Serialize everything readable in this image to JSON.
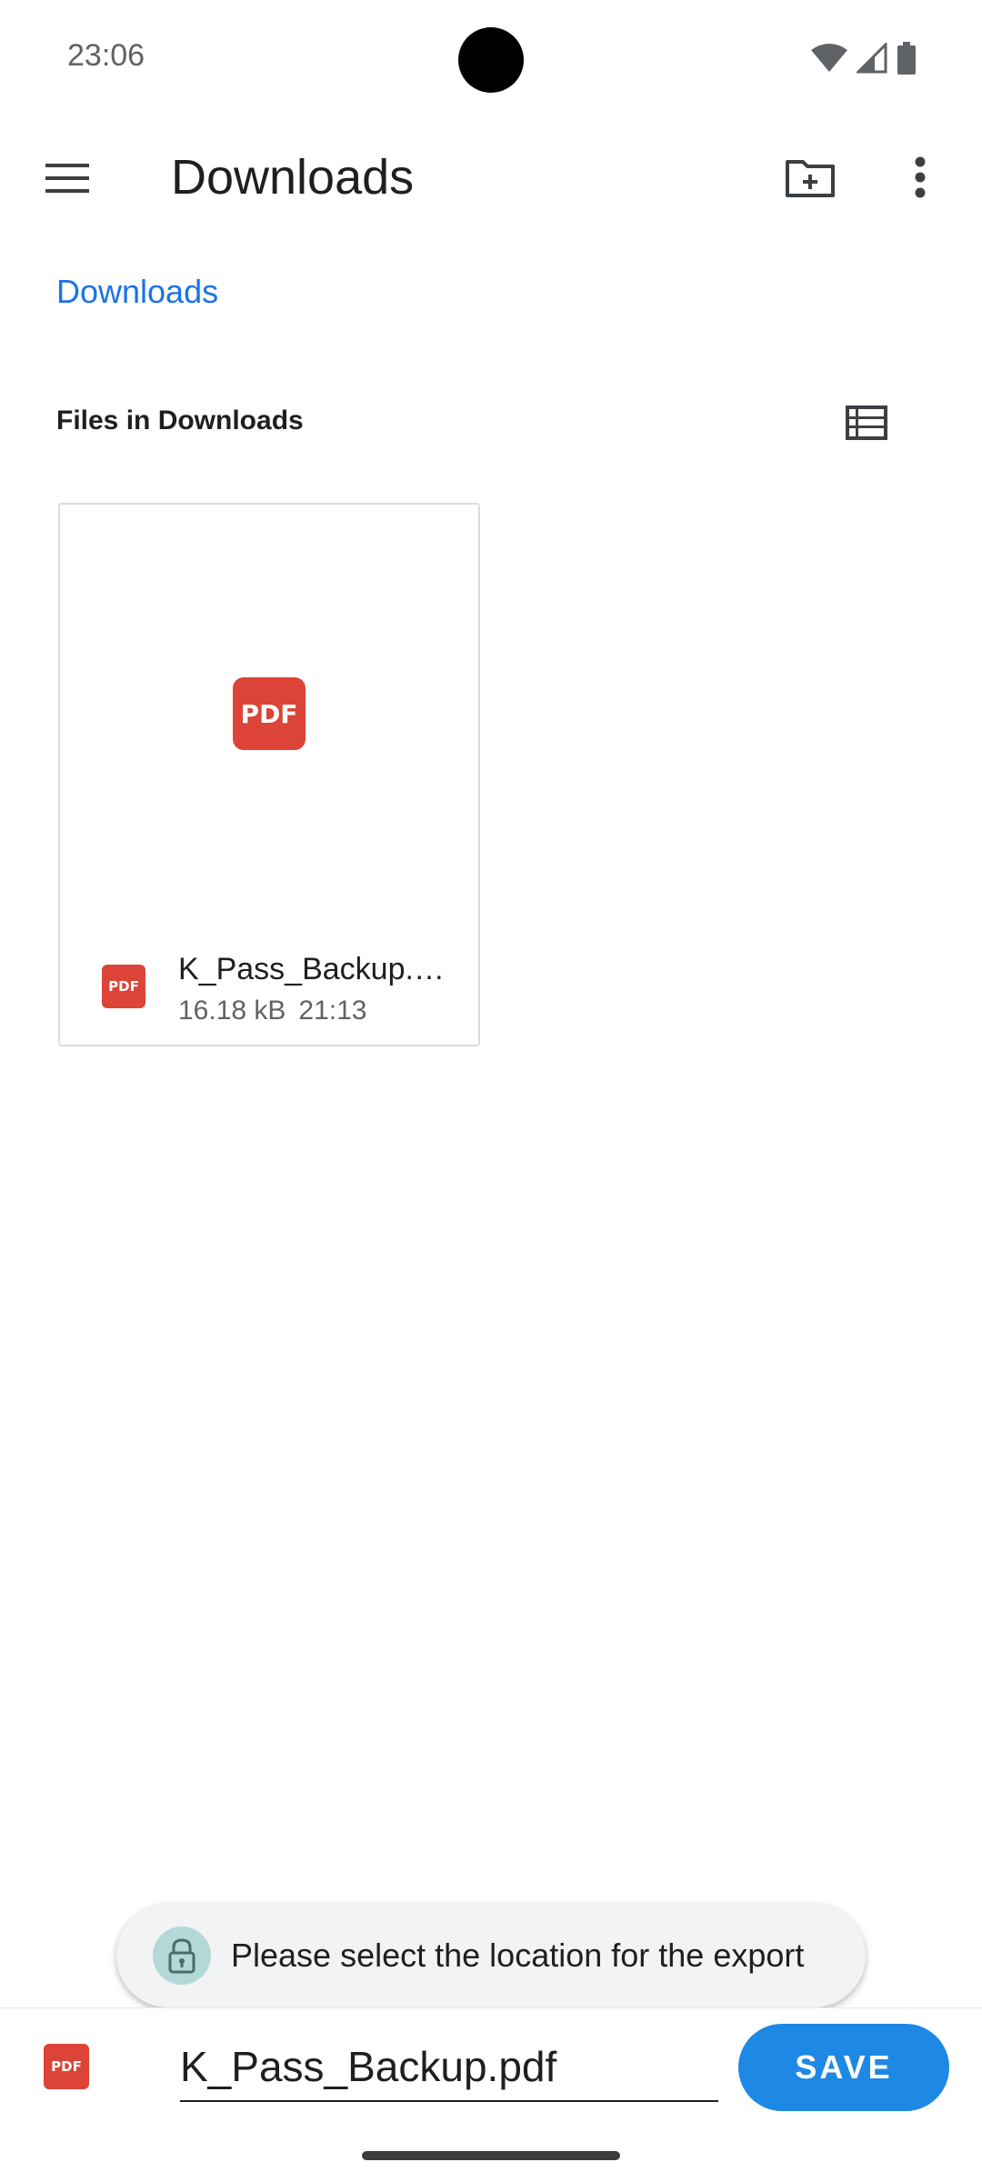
{
  "status_bar": {
    "time": "23:06"
  },
  "app_bar": {
    "title": "Downloads",
    "icons": {
      "menu": "menu-icon",
      "new_folder": "create-new-folder-icon",
      "more": "more-vert-icon"
    }
  },
  "breadcrumb": {
    "label": "Downloads"
  },
  "section": {
    "label": "Files in Downloads",
    "toggle_icon": "list-view-icon"
  },
  "files": [
    {
      "name": "K_Pass_Backup.pdf",
      "size": "16.18 kB",
      "time": "21:13",
      "type_label": "PDF"
    }
  ],
  "snackbar": {
    "message": "Please select the location for the export",
    "icon": "lock-icon"
  },
  "save_bar": {
    "filename_value": "K_Pass_Backup.pdf",
    "file_type_label": "PDF",
    "save_label": "SAVE"
  },
  "colors": {
    "accent": "#1e88e5",
    "link": "#1a73e8",
    "pdf_red": "#db4437"
  }
}
